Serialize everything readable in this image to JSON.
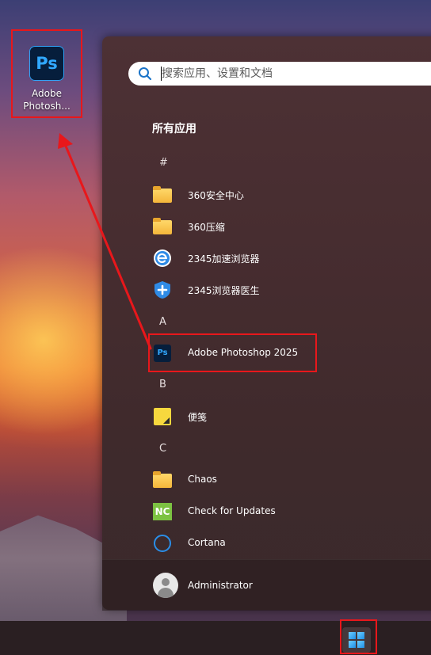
{
  "desktop": {
    "icon_label": "Adobe\nPhotosh...",
    "icon_glyph": "Ps"
  },
  "search": {
    "placeholder": "搜索应用、设置和文档"
  },
  "start_menu": {
    "all_apps_title": "所有应用",
    "groups": [
      {
        "letter": "#",
        "items": [
          {
            "label": "360安全中心",
            "icon": "folder-icon"
          },
          {
            "label": "360压缩",
            "icon": "folder-icon"
          },
          {
            "label": "2345加速浏览器",
            "icon": "browser-e-icon"
          },
          {
            "label": "2345浏览器医生",
            "icon": "shield-plus-icon"
          }
        ]
      },
      {
        "letter": "A",
        "items": [
          {
            "label": "Adobe Photoshop 2025",
            "icon": "photoshop-icon",
            "icon_glyph": "Ps"
          }
        ]
      },
      {
        "letter": "B",
        "items": [
          {
            "label": "便笺",
            "icon": "sticky-notes-icon"
          }
        ]
      },
      {
        "letter": "C",
        "items": [
          {
            "label": "Chaos",
            "icon": "folder-icon"
          },
          {
            "label": "Check for Updates",
            "icon": "nc-icon",
            "icon_glyph": "NC"
          },
          {
            "label": "Cortana",
            "icon": "cortana-icon"
          }
        ]
      }
    ]
  },
  "user": {
    "name": "Administrator"
  },
  "colors": {
    "highlight": "#e8171b",
    "accent": "#2a8ee8"
  }
}
